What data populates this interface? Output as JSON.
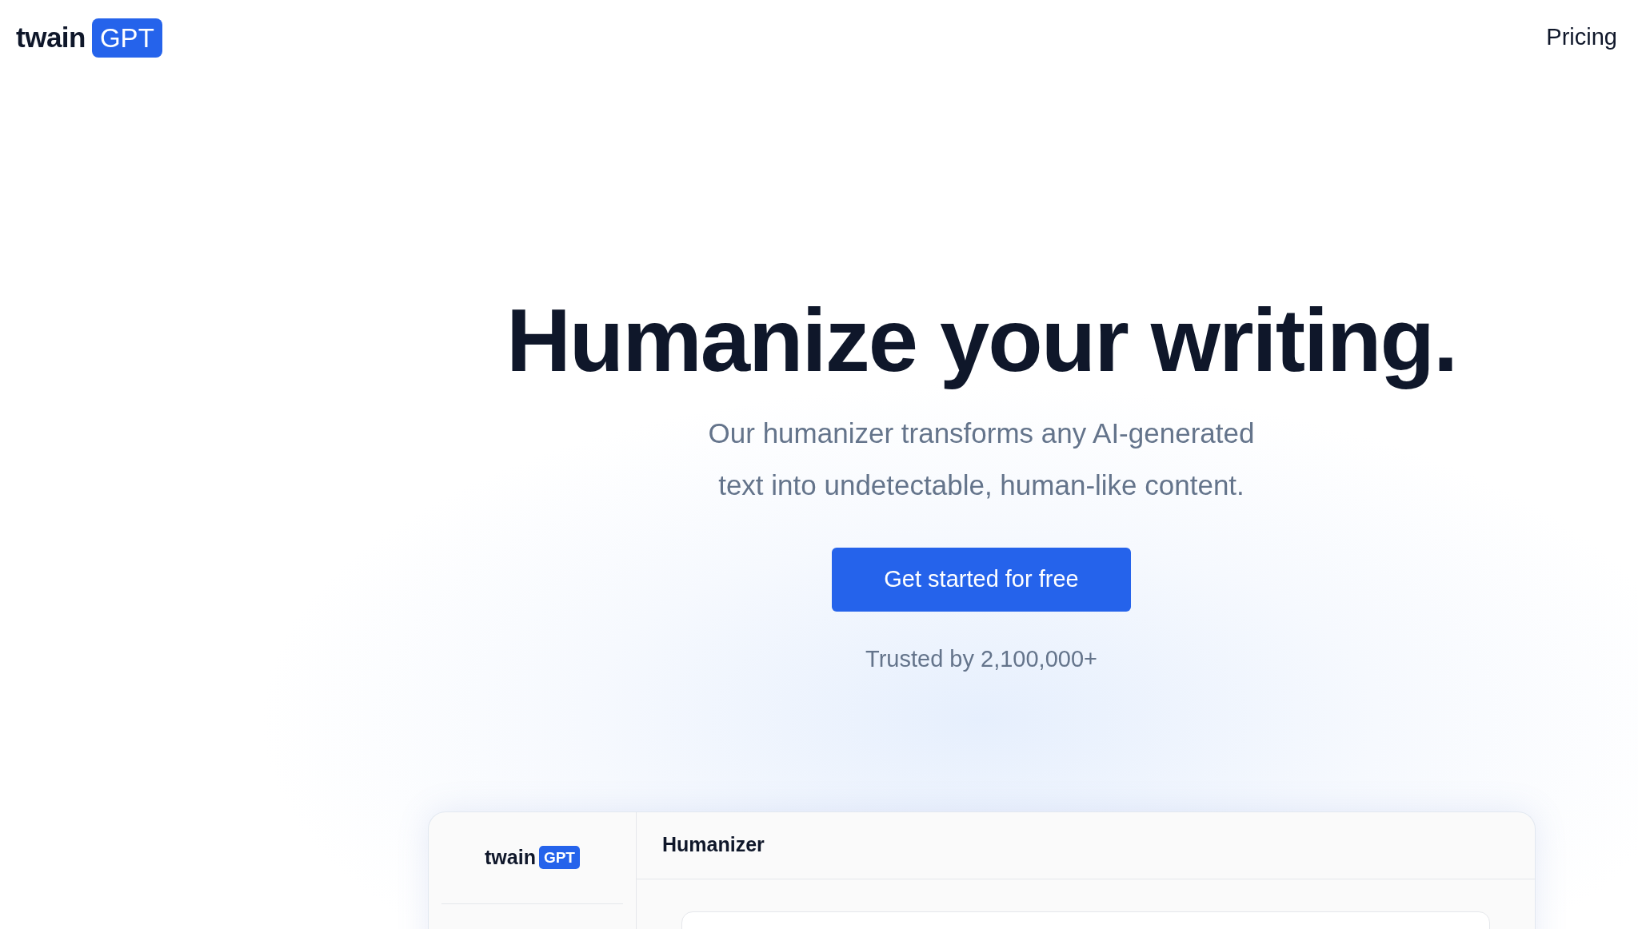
{
  "header": {
    "logo": {
      "word": "twain",
      "badge": "GPT"
    },
    "nav": [
      "Pricing"
    ]
  },
  "hero": {
    "title": "Humanize your writing.",
    "subtitle_lines": [
      "Our humanizer transforms any AI-generated",
      "text into undetectable, human-like content."
    ],
    "cta": "Get started for free",
    "trust": "Trusted by 2,100,000+"
  },
  "app_preview": {
    "logo": {
      "word": "twain",
      "badge": "GPT"
    },
    "title": "Humanizer"
  }
}
